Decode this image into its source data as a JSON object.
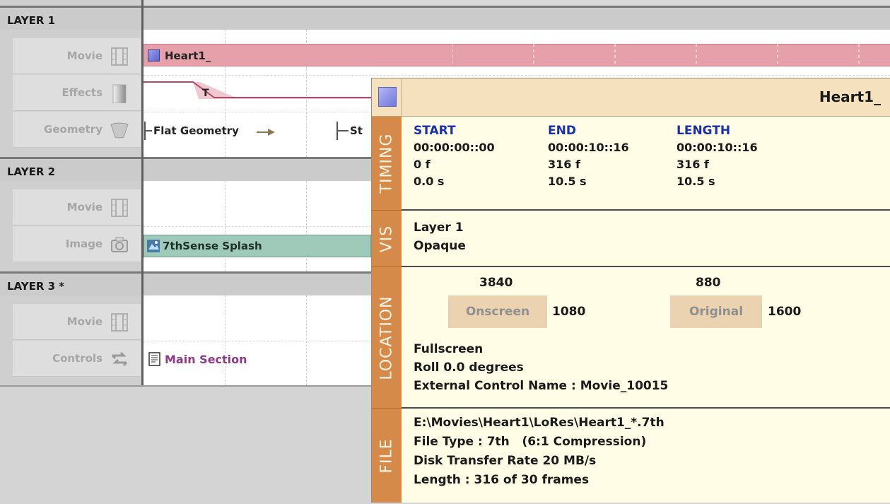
{
  "layers": [
    {
      "name": "LAYER 1",
      "tracks": [
        {
          "label": "Movie",
          "icon": "film-icon"
        },
        {
          "label": "Effects",
          "icon": "gradient-icon"
        },
        {
          "label": "Geometry",
          "icon": "geometry-icon"
        }
      ]
    },
    {
      "name": "LAYER 2",
      "tracks": [
        {
          "label": "Movie",
          "icon": "film-icon"
        },
        {
          "label": "Image",
          "icon": "camera-icon"
        }
      ]
    },
    {
      "name": "LAYER 3 *",
      "tracks": [
        {
          "label": "Movie",
          "icon": "film-icon"
        },
        {
          "label": "Controls",
          "icon": "swap-arrows-icon"
        }
      ]
    }
  ],
  "timeline": {
    "movie_clip": "Heart1_",
    "effect_marker": "T",
    "geometry_clip": "Flat Geometry",
    "geometry_clip_2": "St",
    "image_clip": "7thSense Splash",
    "controls_clip": "Main Section"
  },
  "popup": {
    "title": "Heart1_",
    "tabs": {
      "timing": "TIMING",
      "vis": "VIS",
      "location": "LOCATION",
      "file": "FILE"
    },
    "timing": {
      "headers": [
        "START",
        "END",
        "LENGTH"
      ],
      "timecode": [
        "00:00:00::00",
        "00:00:10::16",
        "00:00:10::16"
      ],
      "frames": [
        "0 f",
        "316 f",
        "316 f"
      ],
      "seconds": [
        "0.0 s",
        "10.5 s",
        "10.5 s"
      ]
    },
    "vis": {
      "layer": "Layer 1",
      "mode": "Opaque"
    },
    "location": {
      "onscreen_label": "Onscreen",
      "onscreen_width": "3840",
      "onscreen_height": "1080",
      "original_label": "Original",
      "original_width": "880",
      "original_height": "1600",
      "mode": "Fullscreen",
      "roll": "Roll 0.0 degrees",
      "external_control": "External Control Name : Movie_10015"
    },
    "file": {
      "path": "E:\\Movies\\Heart1\\LoRes\\Heart1_*.7th",
      "type": "File Type : 7th   (6:1 Compression)",
      "rate": "Disk Transfer Rate 20 MB/s",
      "length": "Length : 316 of 30 frames"
    }
  }
}
